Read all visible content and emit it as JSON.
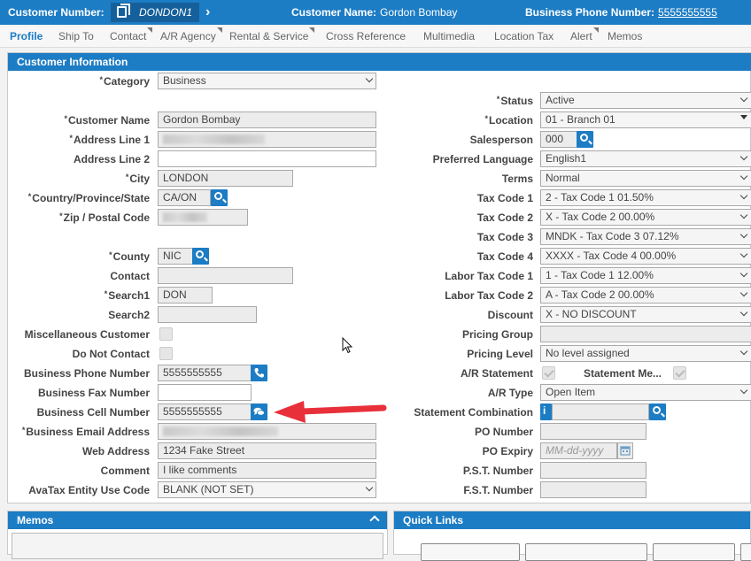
{
  "topbar": {
    "customer_number_label": "Customer Number:",
    "customer_number_value": "DONDON1",
    "customer_name_label": "Customer Name:",
    "customer_name_value": "Gordon Bombay",
    "business_phone_label": "Business Phone Number:",
    "business_phone_value": "5555555555"
  },
  "tabs": [
    "Profile",
    "Ship To",
    "Contact",
    "A/R Agency",
    "Rental & Service",
    "Cross Reference",
    "Multimedia",
    "Location Tax",
    "Alert",
    "Memos"
  ],
  "panel": {
    "title": "Customer Information"
  },
  "left": {
    "category": {
      "label": "Category",
      "value": "Business"
    },
    "customer_name": {
      "label": "Customer Name",
      "value": "Gordon Bombay"
    },
    "address1": {
      "label": "Address Line 1"
    },
    "address2": {
      "label": "Address Line 2",
      "value": ""
    },
    "city": {
      "label": "City",
      "value": "LONDON"
    },
    "country": {
      "label": "Country/Province/State",
      "value": "CA/ON"
    },
    "zip": {
      "label": "Zip / Postal Code"
    },
    "county": {
      "label": "County",
      "value": "NIC"
    },
    "contact": {
      "label": "Contact",
      "value": ""
    },
    "search1": {
      "label": "Search1",
      "value": "DON"
    },
    "search2": {
      "label": "Search2",
      "value": ""
    },
    "misc": {
      "label": "Miscellaneous Customer"
    },
    "dnc": {
      "label": "Do Not Contact"
    },
    "bphone": {
      "label": "Business Phone Number",
      "value": "5555555555"
    },
    "bfax": {
      "label": "Business Fax Number",
      "value": ""
    },
    "bcell": {
      "label": "Business Cell Number",
      "value": "5555555555"
    },
    "email": {
      "label": "Business Email Address"
    },
    "web": {
      "label": "Web Address",
      "value": "1234 Fake Street"
    },
    "comment": {
      "label": "Comment",
      "value": "I like comments"
    },
    "avatax": {
      "label": "AvaTax Entity Use Code",
      "value": "BLANK (NOT SET)"
    }
  },
  "right": {
    "status": {
      "label": "Status",
      "value": "Active"
    },
    "location": {
      "label": "Location",
      "value": "01 - Branch 01"
    },
    "salesperson": {
      "label": "Salesperson",
      "value": "000"
    },
    "language": {
      "label": "Preferred Language",
      "value": "English1"
    },
    "terms": {
      "label": "Terms",
      "value": "Normal"
    },
    "tax1": {
      "label": "Tax Code 1",
      "value": "2 - Tax Code 1 01.50%"
    },
    "tax2": {
      "label": "Tax Code 2",
      "value": "X - Tax Code 2 00.00%"
    },
    "tax3": {
      "label": "Tax Code 3",
      "value": "MNDK - Tax Code 3 07.12%"
    },
    "tax4": {
      "label": "Tax Code 4",
      "value": "XXXX - Tax Code 4 00.00%"
    },
    "labor1": {
      "label": "Labor Tax Code 1",
      "value": "1 - Tax Code 1 12.00%"
    },
    "labor2": {
      "label": "Labor Tax Code 2",
      "value": "A - Tax Code 2 00.00%"
    },
    "discount": {
      "label": "Discount",
      "value": "X - NO DISCOUNT"
    },
    "pricing_group": {
      "label": "Pricing Group",
      "value": ""
    },
    "pricing_level": {
      "label": "Pricing Level",
      "value": "No level assigned"
    },
    "ar_statement": {
      "label": "A/R Statement"
    },
    "statement_me": {
      "label": "Statement Me..."
    },
    "ar_type": {
      "label": "A/R Type",
      "value": "Open Item"
    },
    "stmt_combo": {
      "label": "Statement Combination",
      "value": ""
    },
    "po_number": {
      "label": "PO Number",
      "value": ""
    },
    "po_expiry": {
      "label": "PO Expiry",
      "placeholder": "MM-dd-yyyy"
    },
    "pst": {
      "label": "P.S.T. Number",
      "value": ""
    },
    "fst": {
      "label": "F.S.T. Number",
      "value": ""
    }
  },
  "memos": {
    "title": "Memos"
  },
  "quick_links": {
    "title": "Quick Links"
  },
  "colors": {
    "primary": "#1c7cc4",
    "arrow": "#e8303a"
  }
}
